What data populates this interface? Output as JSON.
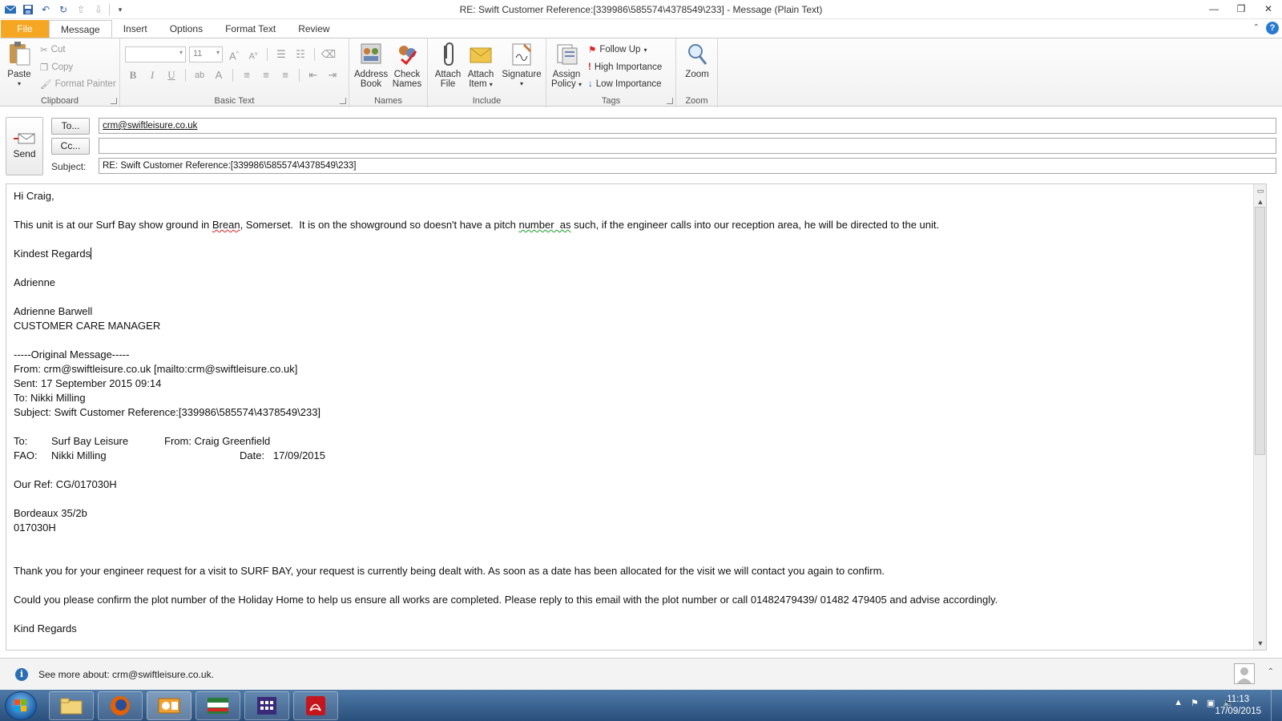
{
  "window": {
    "title": "RE: Swift Customer Reference:[339986\\585574\\4378549\\233]  -  Message (Plain Text)",
    "controls": {
      "minimize": "—",
      "restore": "❐",
      "close": "✕"
    }
  },
  "ribbon_tabs": [
    "File",
    "Message",
    "Insert",
    "Options",
    "Format Text",
    "Review"
  ],
  "ribbon": {
    "clipboard": {
      "label": "Clipboard",
      "paste": "Paste",
      "cut": "Cut",
      "copy": "Copy",
      "format_painter": "Format Painter"
    },
    "basic_text": {
      "label": "Basic Text",
      "font_size": "11"
    },
    "names": {
      "label": "Names",
      "address_book_1": "Address",
      "address_book_2": "Book",
      "check_names_1": "Check",
      "check_names_2": "Names"
    },
    "include": {
      "label": "Include",
      "attach_file_1": "Attach",
      "attach_file_2": "File",
      "attach_item_1": "Attach",
      "attach_item_2": "Item",
      "signature": "Signature"
    },
    "tags": {
      "label": "Tags",
      "assign_policy_1": "Assign",
      "assign_policy_2": "Policy",
      "follow_up": "Follow Up",
      "high_importance": "High Importance",
      "low_importance": "Low Importance"
    },
    "zoom": {
      "label": "Zoom",
      "zoom": "Zoom"
    }
  },
  "header": {
    "send": "Send",
    "to_button": "To...",
    "cc_button": "Cc...",
    "subject_label": "Subject:",
    "to_value": "crm@swiftleisure.co.uk",
    "cc_value": "",
    "subject_value": "RE: Swift Customer Reference:[339986\\585574\\4378549\\233]"
  },
  "body": {
    "greeting": "Hi Craig,",
    "para1_a": "This unit is at our Surf Bay show ground in ",
    "para1_brean": "Brean",
    "para1_b": ", Somerset.  It is on the showground so doesn't have a pitch ",
    "para1_number": "number  as",
    "para1_c": " such, if the engineer calls into our reception area, he will be directed to the unit.",
    "closing": "Kindest Regards",
    "signoff": "Adrienne",
    "sig_name": "Adrienne Barwell",
    "sig_title": "CUSTOMER CARE MANAGER",
    "orig_header": "-----Original Message-----",
    "orig_from": "From: crm@swiftleisure.co.uk [mailto:crm@swiftleisure.co.uk]",
    "orig_sent": "Sent: 17 September 2015 09:14",
    "orig_to": "To: Nikki Milling",
    "orig_subject": "Subject: Swift Customer Reference:[339986\\585574\\4378549\\233]",
    "to_label": "To:",
    "to_val": "Surf Bay Leisure",
    "from_label": "From:",
    "from_val": "Craig Greenfield",
    "fao_label": "FAO:",
    "fao_val": "Nikki Milling",
    "date_label": "Date:",
    "date_val": "17/09/2015",
    "our_ref": "Our Ref: CG/017030H",
    "model": "Bordeaux 35/2b",
    "ref_code": "017030H",
    "para2": "Thank you for your engineer request for a visit to SURF BAY, your request is currently being dealt with. As soon as a date has been allocated for the visit we will contact you again to confirm.",
    "para3": "Could you please confirm the plot number of the Holiday Home to help us ensure all works are completed. Please reply to this email with the plot number or call 01482479439/ 01482 479405 and advise accordingly.",
    "kind_regards": "Kind Regards"
  },
  "people_pane": {
    "see_more": "See more about: crm@swiftleisure.co.uk."
  },
  "taskbar": {
    "time": "11:13",
    "date": "17/09/2015"
  }
}
